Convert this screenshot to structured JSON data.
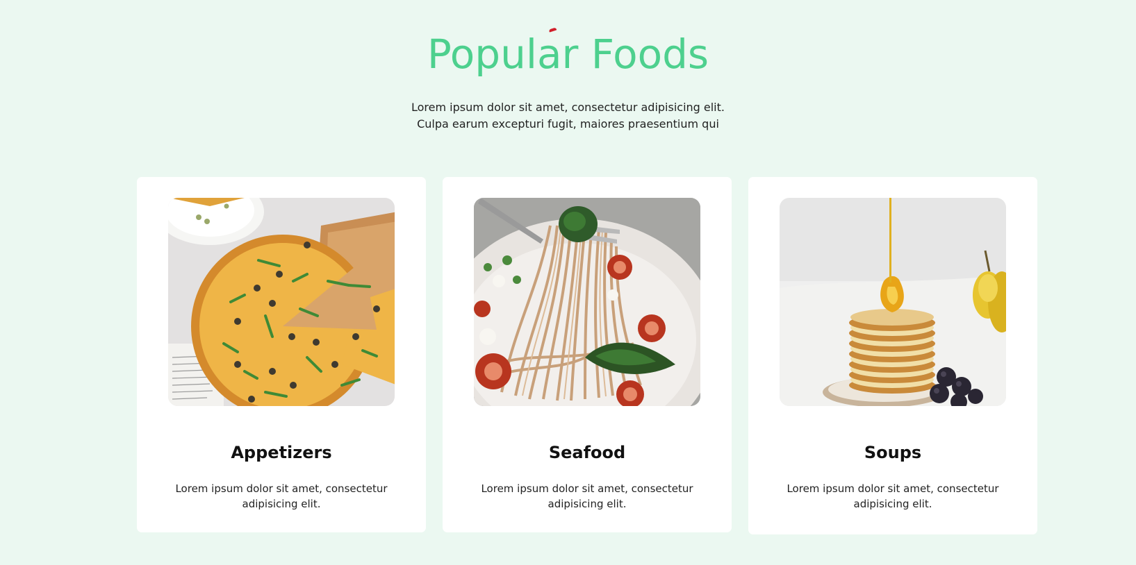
{
  "section": {
    "title": "Popular Foods",
    "subtitle_lines": [
      "Lorem ipsum dolor sit amet, consectetur adipisicing elit.",
      "Culpa earum excepturi fugit, maiores praesentium qui"
    ]
  },
  "cards": [
    {
      "title": "Appetizers",
      "description_lines": [
        "Lorem ipsum dolor sit amet, consectetur",
        "adipisicing elit."
      ],
      "image": "pizza-photo"
    },
    {
      "title": "Seafood",
      "description_lines": [
        "Lorem ipsum dolor sit amet, consectetur",
        "adipisicing elit."
      ],
      "image": "pasta-photo"
    },
    {
      "title": "Soups",
      "description_lines": [
        "Lorem ipsum dolor sit amet, consectetur",
        "adipisicing elit."
      ],
      "image": "pancakes-photo"
    }
  ],
  "colors": {
    "background": "#ebf8f1",
    "title": "#4dd08e",
    "card": "#ffffff"
  }
}
